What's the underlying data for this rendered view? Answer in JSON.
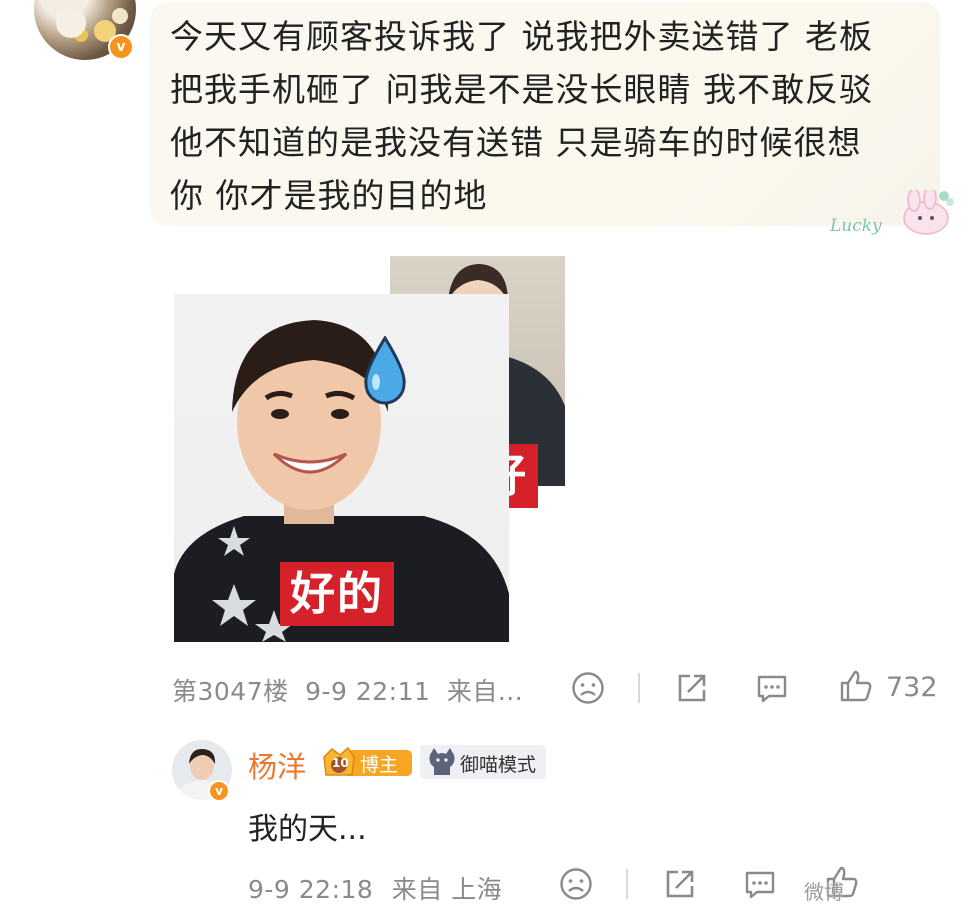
{
  "comment": {
    "lines": [
      "今天又有顾客投诉我了 说我把外卖送错了 老板",
      "把我手机砸了 问我是不是没长眼睛 我不敢反驳",
      "他不知道的是我没有送错 只是骑车的时候很想",
      "你 你才是我的目的地"
    ],
    "sticker_text": "Lucky",
    "verified_mark": "v",
    "meme": {
      "label_back": "不好",
      "label_front": "好的"
    },
    "floor": "第3047楼",
    "time": "9-9 22:11",
    "source": "来自...",
    "like_count": "732"
  },
  "reply": {
    "author": "杨洋",
    "badge_level": "10",
    "badge_role": "博主",
    "badge_mode": "御喵模式",
    "verified_mark": "v",
    "text": "我的天...",
    "time": "9-9 22:18",
    "source": "来自 上海"
  },
  "watermark": "微博",
  "icons": [
    "dislike-icon",
    "share-icon",
    "comment-icon",
    "like-icon"
  ],
  "colors": {
    "accent_orange": "#f7931e",
    "author_name": "#e8792f",
    "meme_label_red": "#d5222a",
    "meta_gray": "#8a8a8a"
  }
}
